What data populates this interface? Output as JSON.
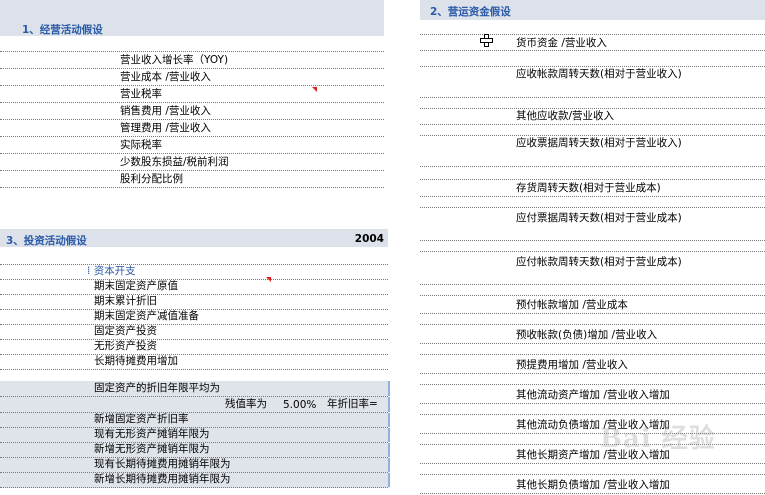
{
  "operating": {
    "title": "1、经营活动假设",
    "rows": [
      "营业收入增长率（YOY)",
      "营业成本 /营业收入",
      "营业税率",
      "销售费用 /营业收入",
      "管理费用 /营业收入",
      "实际税率",
      "少数股东损益/税前利润",
      "股利分配比例"
    ]
  },
  "investing": {
    "title": "3、投资活动假设",
    "year": "2004",
    "rows": [
      "资本开支",
      "期末固定资产原值",
      "期末累计折旧",
      "期末固定资产减值准备",
      "固定资产投资",
      "无形资产投资",
      "长期待摊费用增加"
    ]
  },
  "depreciation": {
    "label": "固定资产的折旧年限平均为",
    "residual_label": "残值率为",
    "residual_value": "5.00%",
    "annual_label": "年折旧率=",
    "rows": [
      "新增固定资产折旧率",
      "现有无形资产摊销年限为",
      "新增无形资产摊销年限为",
      "现有长期待摊费用摊销年限为",
      "新增长期待摊费用摊销年限为"
    ]
  },
  "working_capital": {
    "title": "2、营运资金假设",
    "rows": [
      "货币资金 /营业收入",
      "应收帐款周转天数(相对于营业收入)",
      "其他应收款/营业收入",
      "应收票据周转天数(相对于营业收入)",
      "存货周转天数(相对于营业成本)",
      "应付票据周转天数(相对于营业成本)",
      "应付帐款周转天数(相对于营业成本)",
      "预付帐款增加  /营业成本",
      "预收帐款(负债)增加  /营业收入",
      "预提费用增加 /营业收入",
      "其他流动资产增加 /营业收入增加",
      "其他流动负债增加 /营业收入增加",
      "其他长期资产增加 /营业收入增加",
      "其他长期负债增加 /营业收入增加"
    ]
  },
  "watermark": "Bai 经验",
  "colors": {
    "header_bg": "#dde2ea",
    "header_text": "#2a5aa8",
    "flag": "#e0201a"
  }
}
